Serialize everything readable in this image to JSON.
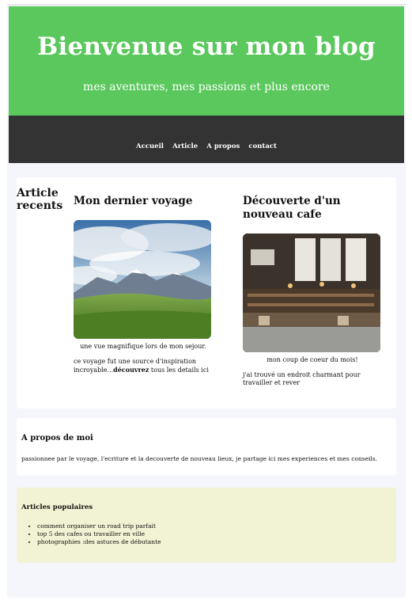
{
  "header": {
    "title": "Bienvenue sur mon blog",
    "subtitle": "mes aventures, mes passions et plus encore",
    "bg_color": "#5ac85c"
  },
  "nav": {
    "bg_color": "#333333",
    "items": [
      "Accueil",
      "Article",
      "A propos",
      "contact"
    ]
  },
  "articles": {
    "side_title": "Article recents",
    "items": [
      {
        "title": "Mon dernier voyage",
        "image": "mountain-landscape-photo",
        "caption": "une vue magnifique lors de mon sejour.",
        "desc_before": "ce voyage fut une source d'inspiration incroyable...",
        "desc_bold": "découvrez",
        "desc_after": " tous les details ici"
      },
      {
        "title": "Découverte d'un nouveau cafe",
        "image": "cafe-interior-photo",
        "caption": "mon coup de coeur du mois!",
        "desc": "j'ai trouvé un endroit charmant pour travailler et rever"
      }
    ]
  },
  "about": {
    "title": "A propos de moi",
    "text": "passionnee par le voyage, l'ecriture et la decouverte de nouveau lieux, je partage ici mes experiences et mes conseils."
  },
  "popular": {
    "title": "Articles populaires",
    "bg_color": "#f2f2d4",
    "items": [
      "comment organiser un road trip parfait",
      "top 5 des cafes ou travailler en ville",
      "photographies :des astuces de débutante"
    ]
  }
}
